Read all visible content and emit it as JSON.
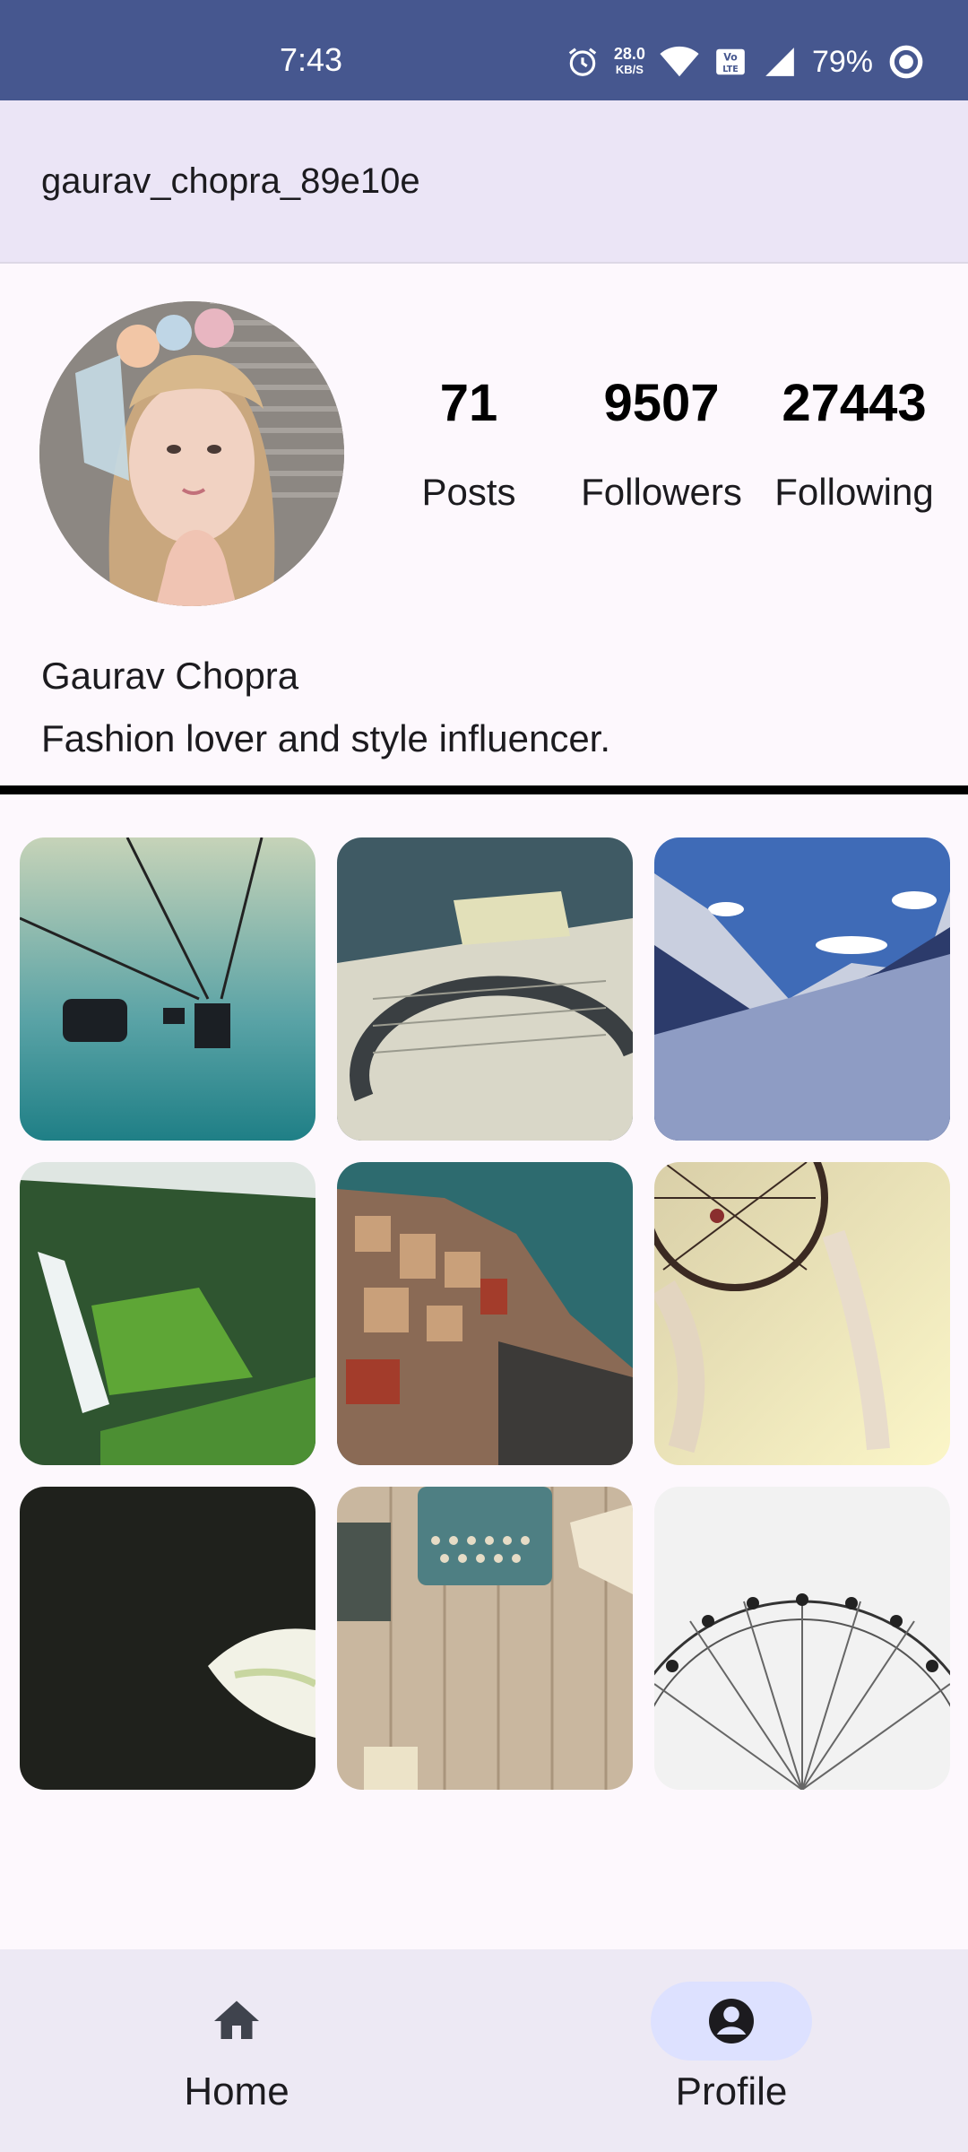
{
  "status_bar": {
    "time": "7:43",
    "net_speed_value": "28.0",
    "net_speed_unit": "KB/S",
    "battery": "79%"
  },
  "app_bar": {
    "username": "gaurav_chopra_89e10e"
  },
  "profile": {
    "display_name": "Gaurav Chopra",
    "bio": "Fashion lover and style influencer.",
    "stats": [
      {
        "value": "71",
        "label": "Posts"
      },
      {
        "value": "9507",
        "label": "Followers"
      },
      {
        "value": "27443",
        "label": "Following"
      }
    ]
  },
  "grid": {
    "tiles": [
      "cable-car",
      "document",
      "mountains",
      "waterfall",
      "cliff-town",
      "dreamcatcher",
      "calla-lily",
      "typewriter",
      "ferris-wheel"
    ]
  },
  "bottom_nav": {
    "items": [
      {
        "label": "Home",
        "icon": "home-icon",
        "active": false
      },
      {
        "label": "Profile",
        "icon": "account-circle-icon",
        "active": true
      }
    ]
  },
  "colors": {
    "status_bar": "#46578f",
    "app_bar": "#ebe5f6",
    "nav_active": "#dde1ff",
    "bottom_nav": "#ede9f4"
  }
}
